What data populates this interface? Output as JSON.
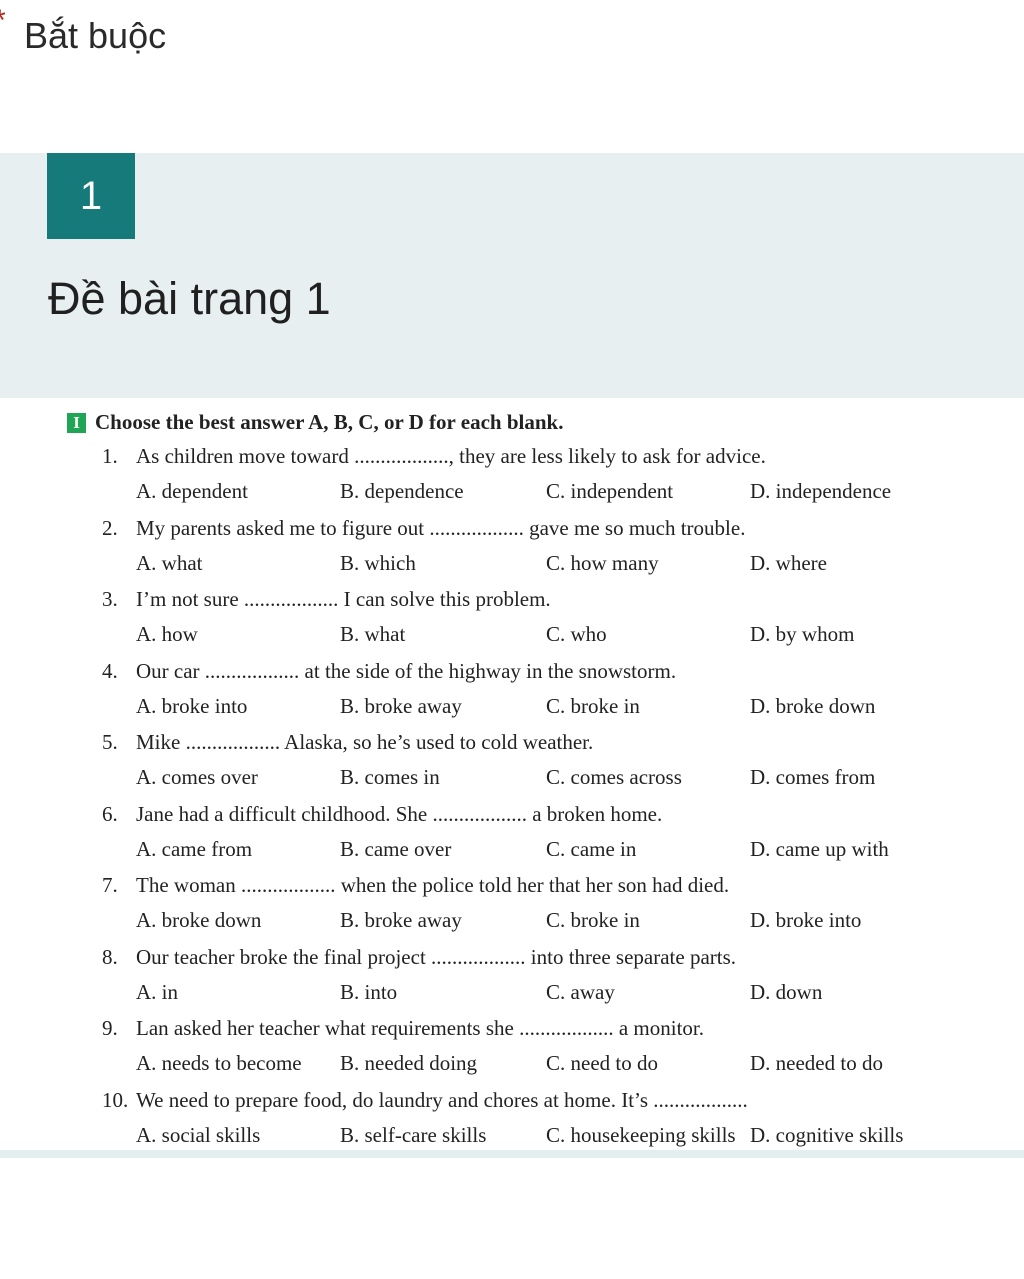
{
  "form": {
    "required_marker": "*",
    "required_label": "Bắt buộc"
  },
  "section": {
    "number": "1",
    "title": "Đề bài trang 1"
  },
  "worksheet": {
    "roman_numeral": "I",
    "instruction": "Choose the best answer A, B, C, or D for each blank.",
    "questions": [
      {
        "num": "1.",
        "text": "As children move toward .................., they are less likely to ask for advice.",
        "options": [
          "A. dependent",
          "B. dependence",
          "C. independent",
          "D. independence"
        ]
      },
      {
        "num": "2.",
        "text": "My parents asked me to figure out .................. gave me so much trouble.",
        "options": [
          "A. what",
          "B. which",
          "C. how many",
          "D. where"
        ]
      },
      {
        "num": "3.",
        "text": "I’m not sure .................. I can solve this problem.",
        "options": [
          "A. how",
          "B. what",
          "C. who",
          "D. by whom"
        ]
      },
      {
        "num": "4.",
        "text": "Our car .................. at the side of the highway in the snowstorm.",
        "options": [
          "A. broke into",
          "B. broke away",
          "C. broke in",
          "D. broke down"
        ]
      },
      {
        "num": "5.",
        "text": "Mike .................. Alaska, so he’s used to cold weather.",
        "options": [
          "A. comes over",
          "B. comes in",
          "C. comes across",
          "D. comes from"
        ]
      },
      {
        "num": "6.",
        "text": "Jane had a difficult childhood. She .................. a broken home.",
        "options": [
          "A. came from",
          "B. came over",
          "C. came in",
          "D. came up with"
        ]
      },
      {
        "num": "7.",
        "text": "The woman .................. when the police told her that her son had died.",
        "options": [
          "A. broke down",
          "B. broke away",
          "C. broke in",
          "D. broke into"
        ]
      },
      {
        "num": "8.",
        "text": "Our teacher broke the final project .................. into three separate parts.",
        "options": [
          "A. in",
          "B. into",
          "C. away",
          "D. down"
        ]
      },
      {
        "num": "9.",
        "text": "Lan asked her teacher what requirements she .................. a monitor.",
        "options": [
          "A. needs to become",
          "B. needed doing",
          "C. need to do",
          "D. needed to do"
        ]
      },
      {
        "num": "10.",
        "text": "We need to prepare food, do laundry and chores at home. It’s ..................",
        "options": [
          "A. social skills",
          "B. self-care skills",
          "C. housekeeping skills",
          "D. cognitive skills"
        ]
      }
    ]
  },
  "colors": {
    "required_star": "#b3261e",
    "section_badge": "#167a7a",
    "section_bg": "#e7eff1",
    "roman_badge": "#1fa555"
  }
}
